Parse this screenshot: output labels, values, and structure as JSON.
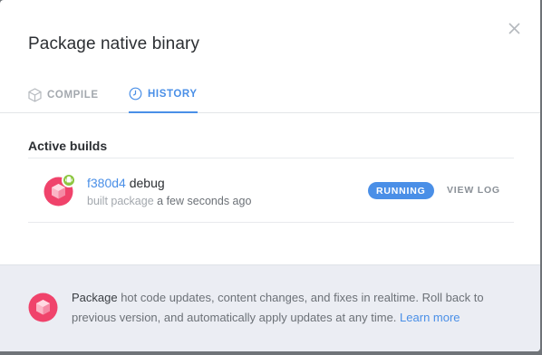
{
  "modal": {
    "title": "Package native binary"
  },
  "tabs": [
    {
      "label": "COMPILE",
      "icon": "cube-icon",
      "active": false
    },
    {
      "label": "HISTORY",
      "icon": "clock-icon",
      "active": true
    }
  ],
  "section": {
    "title": "Active builds"
  },
  "build": {
    "hash": "f380d4",
    "name": "debug",
    "action": "built package",
    "time": "a few seconds ago",
    "platform_icon": "android-icon",
    "status": "RUNNING",
    "view_log_label": "VIEW LOG"
  },
  "footer": {
    "strong": "Package",
    "text": " hot code updates, content changes, and fixes in realtime. Roll back to previous version, and automatically apply updates at any time. ",
    "link": "Learn more"
  },
  "colors": {
    "accent": "#4a8fe7",
    "brand_pink": "#f0436b",
    "android_green": "#8cc63f",
    "footer_bg": "#ebedf3"
  }
}
